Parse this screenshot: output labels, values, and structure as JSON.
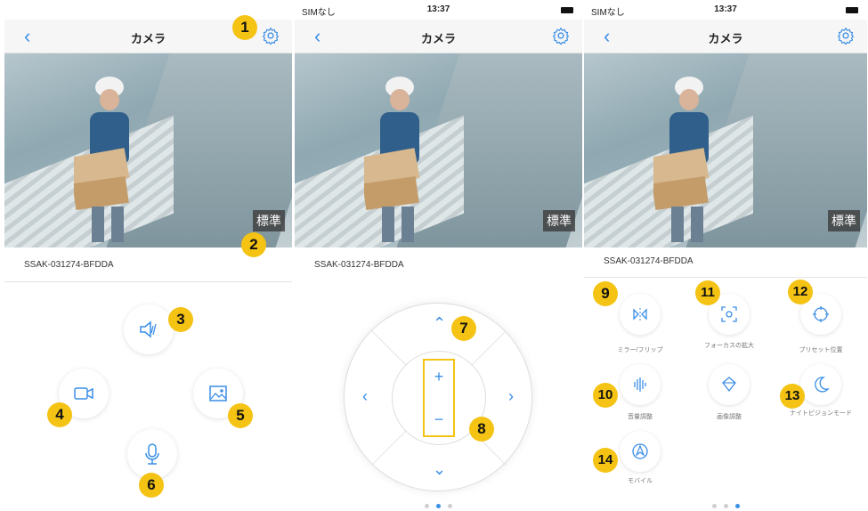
{
  "status": {
    "carrier": "SIMなし",
    "time": "13:37"
  },
  "nav": {
    "title": "カメラ"
  },
  "camera": {
    "quality_label": "標準"
  },
  "device": {
    "name": "SSAK-031274-BFDDA"
  },
  "badges": [
    "1",
    "2",
    "3",
    "4",
    "5",
    "6",
    "7",
    "8",
    "9",
    "10",
    "11",
    "12",
    "13",
    "14"
  ],
  "functions": {
    "mirror_flip": "ミラー/フリップ",
    "focus": "フォーカスの拡大",
    "preset": "プリセット位置",
    "volume": "音量調整",
    "image": "画像調整",
    "night_vision": "ナイトビジョンモード",
    "mobile": "モバイル"
  },
  "ptz": {
    "zoom_in": "+",
    "zoom_out": "−"
  },
  "colors": {
    "accent": "#3a8ee6",
    "badge": "#f4c313"
  },
  "icons": [
    "back-arrow-icon",
    "gear-icon",
    "mute-icon",
    "video-record-icon",
    "snapshot-icon",
    "microphone-icon",
    "mirror-flip-icon",
    "focus-icon",
    "preset-icon",
    "volume-icon",
    "image-adjust-icon",
    "night-vision-icon",
    "mobile-tracking-icon"
  ]
}
